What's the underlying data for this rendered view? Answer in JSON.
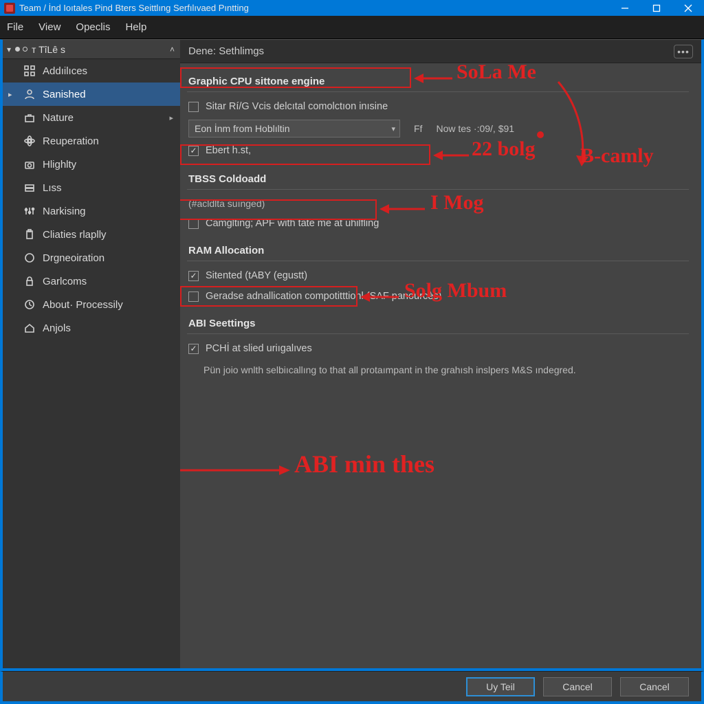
{
  "window": {
    "title": "Team / İnd Ioıtales Pind Bters Seittlıng Serfılıvaed Pıntting"
  },
  "menubar": [
    "File",
    "View",
    "Opeclis",
    "Help"
  ],
  "sidebar": {
    "header": "ᴛ TîLê s",
    "items": [
      {
        "label": "Addıilıces",
        "icon": "grid",
        "active": false
      },
      {
        "label": "Sanished",
        "icon": "user",
        "active": true,
        "expandable": true
      },
      {
        "label": "Nature",
        "icon": "case",
        "active": false,
        "hasSubmenu": true
      },
      {
        "label": "Reuperation",
        "icon": "atom",
        "active": false
      },
      {
        "label": "Hlighlty",
        "icon": "camera",
        "active": false
      },
      {
        "label": "Lıss",
        "icon": "drive",
        "active": false
      },
      {
        "label": "Narkising",
        "icon": "sliders",
        "active": false
      },
      {
        "label": "Cliaties rlaplly",
        "icon": "clipboard",
        "active": false
      },
      {
        "label": "Drgneoiration",
        "icon": "circle",
        "active": false
      },
      {
        "label": "Garlcoms",
        "icon": "lock",
        "active": false
      },
      {
        "label": "About· Processily",
        "icon": "clock",
        "active": false
      },
      {
        "label": "Anjols",
        "icon": "home",
        "active": false
      }
    ]
  },
  "main": {
    "header": "Dene: Sethlimgs",
    "sections": {
      "graphic": {
        "title": "Graphic CPU sittone engine",
        "chk_sitar": {
          "label": "Sitar Rí/G Vcis delcıtal comolctıon inısine",
          "checked": false
        },
        "dropdown": {
          "value": "Eon İnm from Hoblıltin",
          "aux_prefix": "Ff",
          "aux": "Now tes ·:09/, $91"
        },
        "chk_ebert": {
          "label": "Ebert h.st,",
          "checked": true
        }
      },
      "tbss": {
        "title": "TBSS Coldoadd",
        "subnote": "(#acldlta suınged)",
        "chk_camg": {
          "label": "Camglting; APF with tate me at uhilfling",
          "checked": false
        }
      },
      "ram": {
        "title": "RAM Allocation",
        "chk_sitented": {
          "label": "Sitented (tABY (egustt)",
          "checked": true
        },
        "chk_gerade": {
          "label": "Geradse adnallication compotitttionl (SAF panourcès)",
          "checked": false
        }
      },
      "abi": {
        "title": "ABI Seettings",
        "chk_pchi": {
          "label": "PCHİ at slied uriıgalıves",
          "checked": true
        },
        "help": "Pün joio wnlth selbiıcallıng to that all protaımpant in the grahısh inslpers M&S ındegred."
      }
    }
  },
  "footer": {
    "ok": "Uy Teil",
    "cancel1": "Cancel",
    "cancel2": "Cancel"
  },
  "annotations": {
    "sola_me": "SoLa Me",
    "bcamly": "B-camly",
    "bolg22": "22 bolg",
    "imog": "I  Mog",
    "solg_mbm": "Solg  Mbum",
    "abi_min": "ABI min thes"
  }
}
